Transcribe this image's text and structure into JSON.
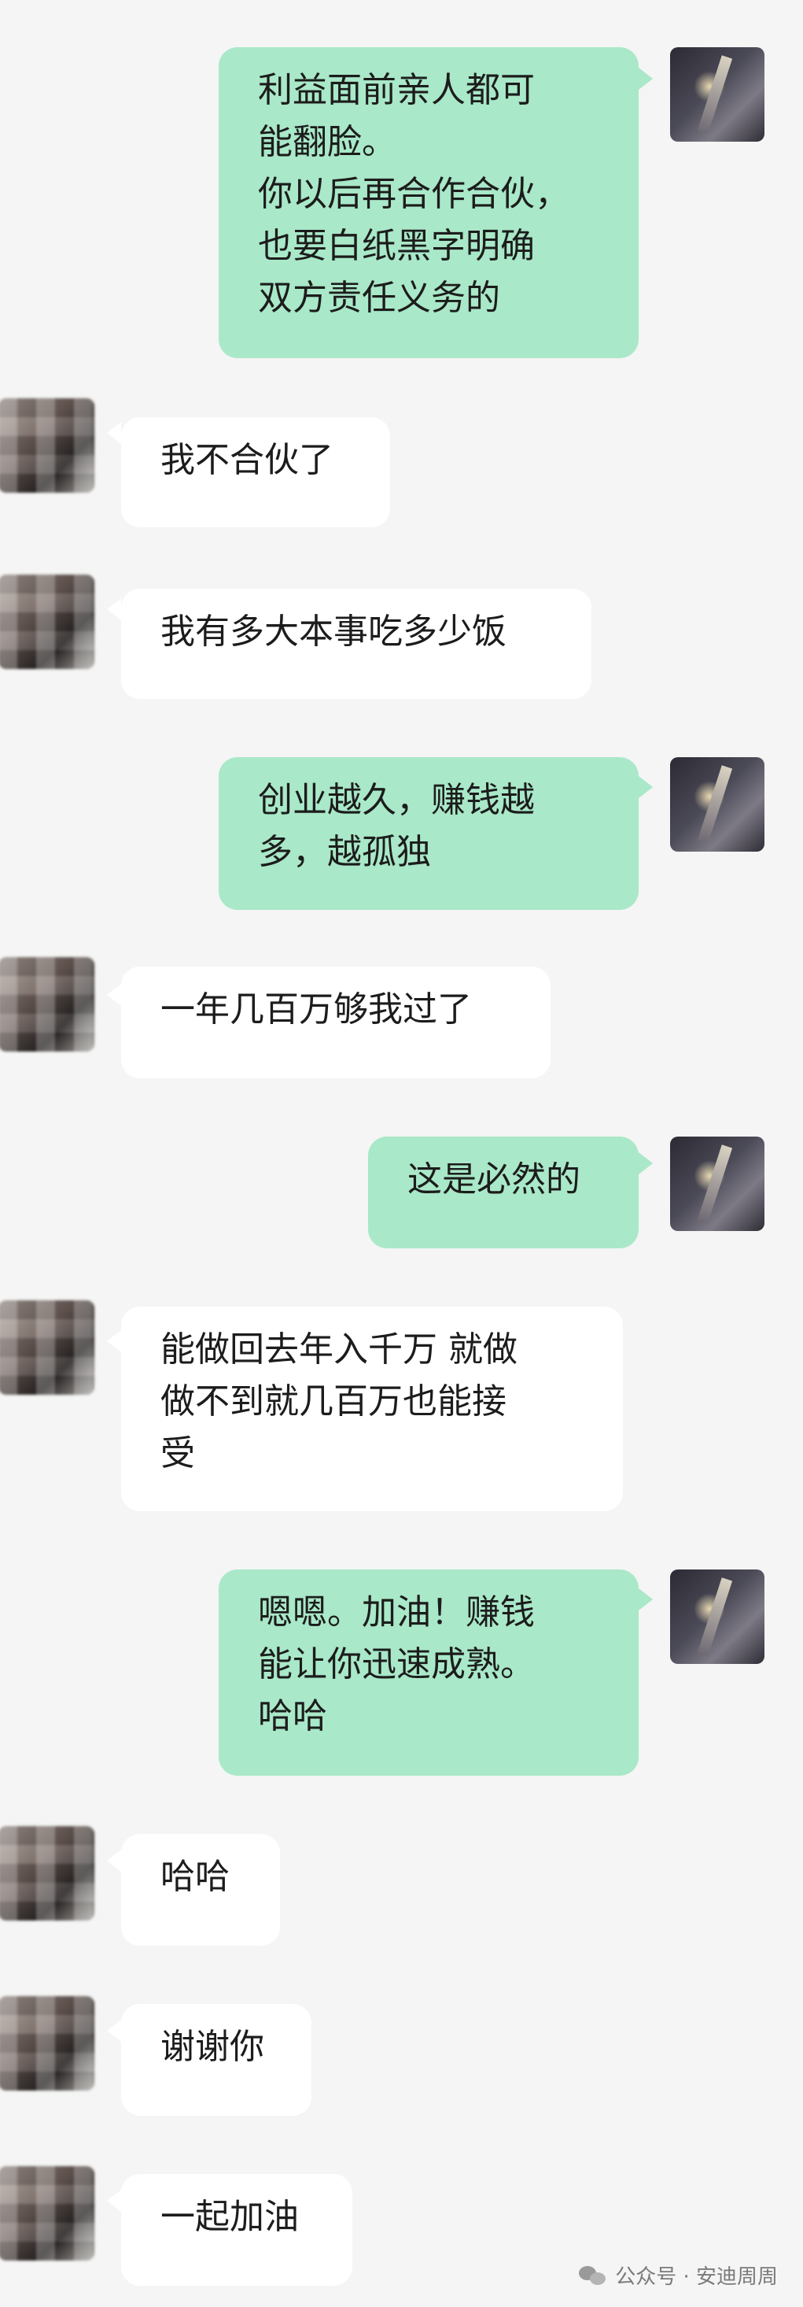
{
  "messages": [
    {
      "sender": "me",
      "text": "利益面前亲人都可\n能翻脸。\n你以后再合作合伙，\n也要白纸黑字明确\n双方责任义务的"
    },
    {
      "sender": "other",
      "text": "我不合伙了"
    },
    {
      "sender": "other",
      "text": "我有多大本事吃多少饭"
    },
    {
      "sender": "me",
      "text": "创业越久，赚钱越\n多，越孤独"
    },
    {
      "sender": "other",
      "text": "一年几百万够我过了"
    },
    {
      "sender": "me",
      "text": "这是必然的"
    },
    {
      "sender": "other",
      "text": "能做回去年入千万 就做\n做不到就几百万也能接\n受"
    },
    {
      "sender": "me",
      "text": "嗯嗯。加油！赚钱\n能让你迅速成熟。\n哈哈"
    },
    {
      "sender": "other",
      "text": "哈哈"
    },
    {
      "sender": "other",
      "text": "谢谢你"
    },
    {
      "sender": "other",
      "text": "一起加油"
    }
  ],
  "watermark": {
    "text": "公众号 · 安迪周周",
    "icon": "wechat-icon"
  },
  "colors": {
    "background": "#f4f5f4",
    "my_bubble": "#a9e8c8",
    "other_bubble": "#ffffff"
  }
}
